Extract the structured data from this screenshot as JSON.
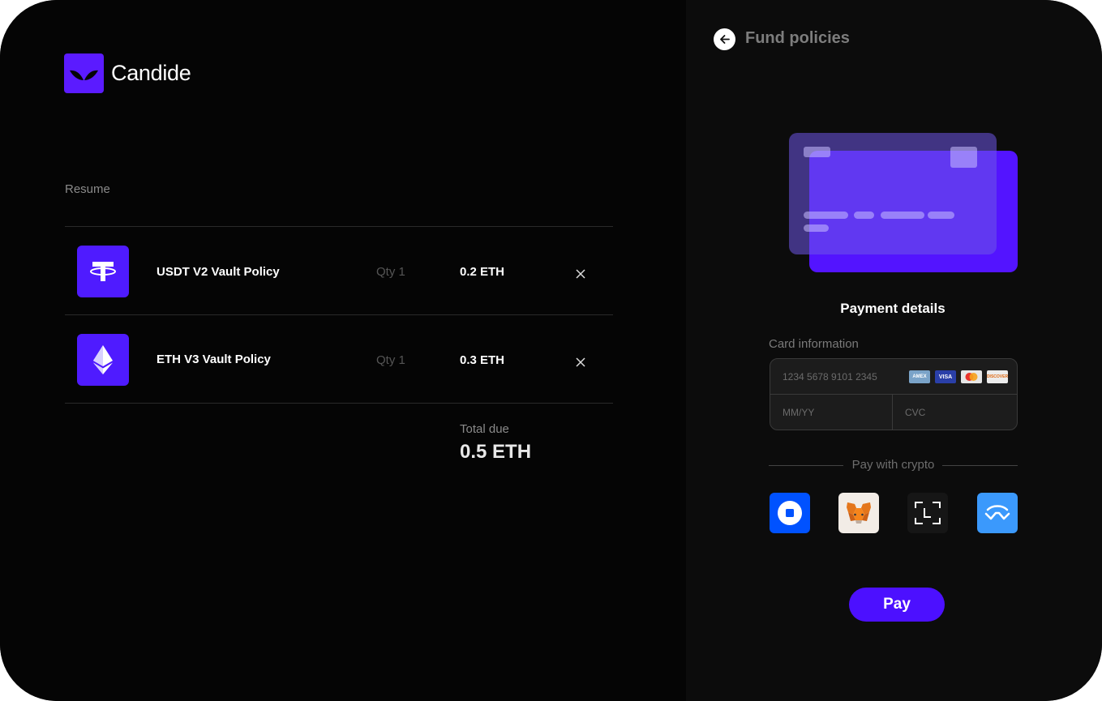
{
  "brand": {
    "name": "Candide",
    "accent": "#5b1bff"
  },
  "cart": {
    "section_label": "Resume",
    "items": [
      {
        "name": "USDT V2 Vault Policy",
        "qty": "Qty 1",
        "price": "0.2 ETH",
        "icon": "tether-icon"
      },
      {
        "name": "ETH V3 Vault Policy",
        "qty": "Qty 1",
        "price": "0.3 ETH",
        "icon": "ethereum-icon"
      }
    ],
    "total_label": "Total due",
    "total_value": "0.5 ETH"
  },
  "panel": {
    "title": "Fund policies",
    "payment_details": "Payment details",
    "card_info_label": "Card information",
    "card_number_placeholder": "1234 5678 9101 2345",
    "expiry_placeholder": "MM/YY",
    "cvc_placeholder": "CVC",
    "card_brands": [
      "AMEX",
      "VISA",
      "mastercard",
      "DISCOVER"
    ],
    "crypto_label": "Pay with crypto",
    "wallets": [
      "coinbase-wallet-icon",
      "metamask-icon",
      "ledger-icon",
      "walletconnect-icon"
    ],
    "pay_label": "Pay"
  }
}
